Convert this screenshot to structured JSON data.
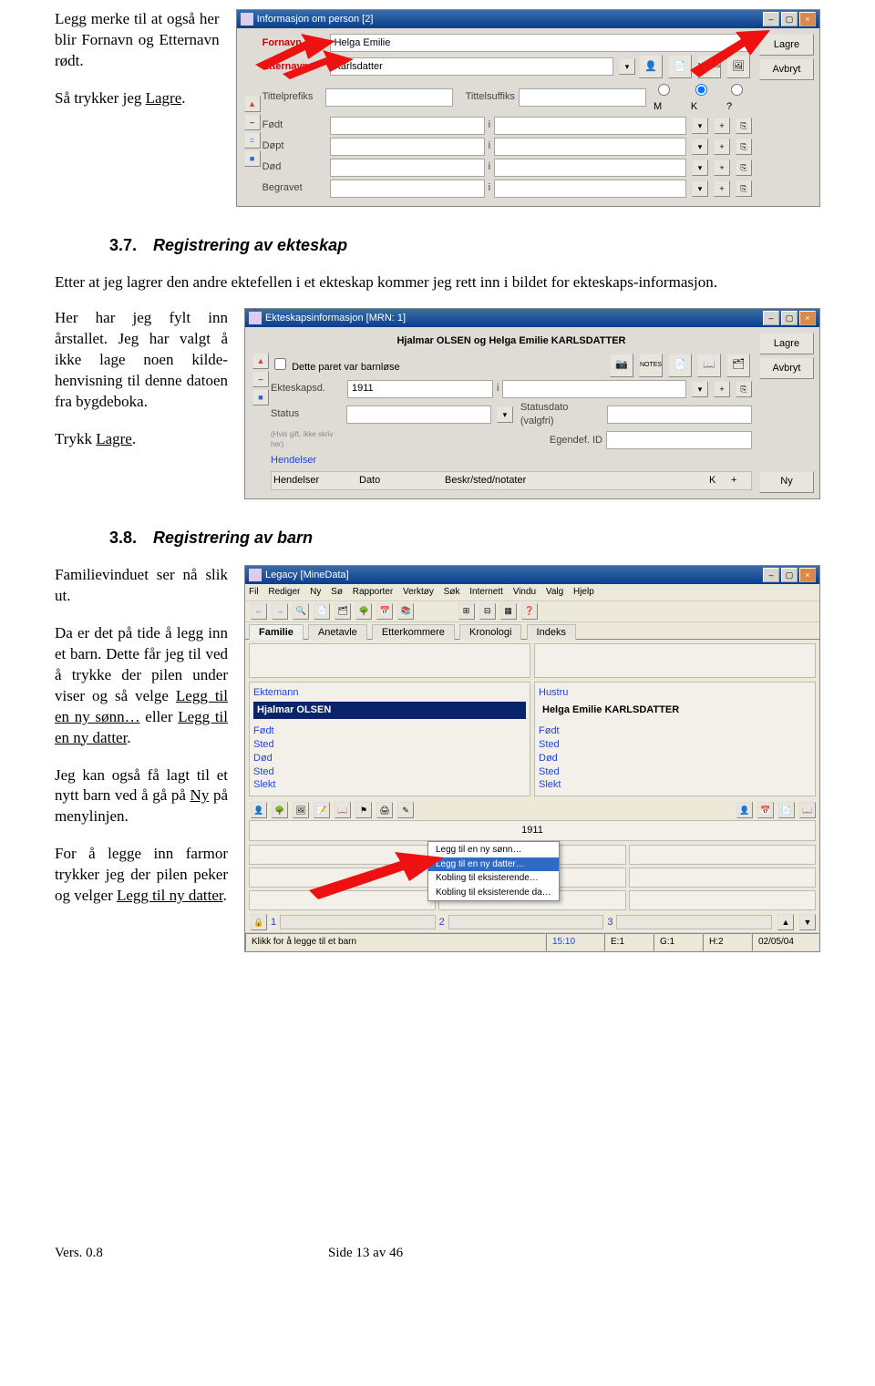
{
  "para1": "Legg merke til at også her blir Fornavn og Etternavn rødt.",
  "para2a": "Så trykker jeg ",
  "para2b": "Lagre",
  "para2c": ".",
  "sec37_num": "3.7.",
  "sec37_title": "Registrering av ekteskap",
  "sec37_body": "Etter at jeg lagrer den andre ektefellen i et ekteskap kommer jeg rett inn i bildet for ekteskaps-informasjon.",
  "para3": "Her har jeg fylt inn årstallet. Jeg har valgt å ikke lage noen kilde-henvisning til denne datoen fra bygdeboka.",
  "para4a": "Trykk ",
  "para4b": "Lagre",
  "para4c": ".",
  "sec38_num": "3.8.",
  "sec38_title": "Registrering av barn",
  "para5": "Familievinduet ser nå slik ut.",
  "para6a": "Da er det på tide å legg inn et barn. Dette får jeg til ved å trykke der pilen under viser og så velge ",
  "para6b": "Legg til en ny sønn…",
  "para6c": " eller ",
  "para6d": "Legg til en ny datter",
  "para6e": ".",
  "para7a": "Jeg kan også få lagt til et nytt barn ved å gå på ",
  "para7b": "Ny",
  "para7c": " på menylinjen.",
  "para8a": "For å legge inn farmor trykker jeg der pilen peker og velger ",
  "para8b": "Legg til ny datter",
  "para8c": ".",
  "footer_left": "Vers. 0.8",
  "footer_center": "Side 13 av 46",
  "win1": {
    "title": "Informasjon om person  [2]",
    "btn_save": "Lagre",
    "btn_cancel": "Avbryt",
    "lbl_fornavn": "Fornavn",
    "val_fornavn": "Helga Emilie",
    "lbl_etternavn": "Etternavn",
    "val_etternavn": "Karlsdatter",
    "lbl_prefix": "Tittelprefiks",
    "lbl_suffix": "Tittelsuffiks",
    "gender_m": "M",
    "gender_k": "K",
    "gender_q": "?",
    "lbl_fodt": "Født",
    "lbl_dopt": "Døpt",
    "lbl_dod": "Død",
    "lbl_begravet": "Begravet",
    "col_i": "i"
  },
  "win2": {
    "title": "Ekteskapsinformasjon  [MRN: 1]",
    "heading": "Hjalmar OLSEN og Helga Emilie KARLSDATTER",
    "btn_save": "Lagre",
    "btn_cancel": "Avbryt",
    "chk_barren": "Dette paret var barnløse",
    "lbl_ektdato": "Ekteskapsd.",
    "val_ektdato": "1911",
    "col_i": "i",
    "lbl_status": "Status",
    "lbl_statusdato": "Statusdato (valgfri)",
    "hint": "(Hvis gift, ikke skriv her)",
    "lbl_egendef": "Egendef. ID",
    "lbl_hendelser": "Hendelser",
    "col_h": "Hendelser",
    "col_d": "Dato",
    "col_b": "Beskr/sted/notater",
    "col_k": "K",
    "col_plus": "+",
    "btn_ny": "Ny"
  },
  "win3": {
    "title": "Legacy  [MineData]",
    "menus": [
      "Fil",
      "Rediger",
      "Ny",
      "Sø",
      "Rapporter",
      "Verktøy",
      "Søk",
      "Internett",
      "Vindu",
      "Valg",
      "Hjelp"
    ],
    "tabs": [
      "Familie",
      "Anetavle",
      "Etterkommere",
      "Kronologi",
      "Indeks"
    ],
    "lbl_ektemann": "Ektemann",
    "val_ektemann": "Hjalmar OLSEN",
    "lbl_hustru": "Hustru",
    "val_hustru": "Helga Emilie KARLSDATTER",
    "fields": [
      "Født",
      "Sted",
      "Død",
      "Sted",
      "Slekt"
    ],
    "year": "1911",
    "menu_items": [
      "Legg til en ny sønn…",
      "Legg til en ny datter…",
      "Kobling til eksisterende…",
      "Kobling til eksisterende da…"
    ],
    "status_children": [
      "1",
      "2",
      "3"
    ],
    "status_hint": "Klikk for å legge til et barn",
    "status_time": "15:10",
    "status_e": "E:1",
    "status_g": "G:1",
    "status_h": "H:2",
    "status_date": "02/05/04"
  }
}
